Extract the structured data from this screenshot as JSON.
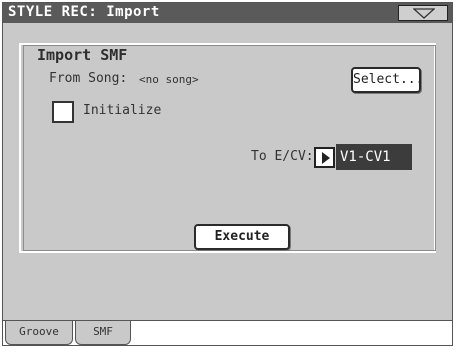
{
  "title": "STYLE REC: Import",
  "menu_icon": "triangle-down-icon",
  "group_title": "Import SMF",
  "from_song": {
    "label": "From Song:",
    "value": "<no song>"
  },
  "select_button": "Select...",
  "initialize": {
    "label": "Initialize",
    "checked": false
  },
  "to_ecv": {
    "label": "To E/CV:",
    "value": "V1-CV1",
    "arrow_icon": "play-arrow-icon"
  },
  "execute_button": "Execute",
  "tabs": [
    {
      "label": "Groove",
      "active": false
    },
    {
      "label": "SMF",
      "active": true
    }
  ],
  "colors": {
    "title_bar": "#5a5a5a",
    "background": "#c9c9c9",
    "value_highlight": "#3c3c3c"
  }
}
